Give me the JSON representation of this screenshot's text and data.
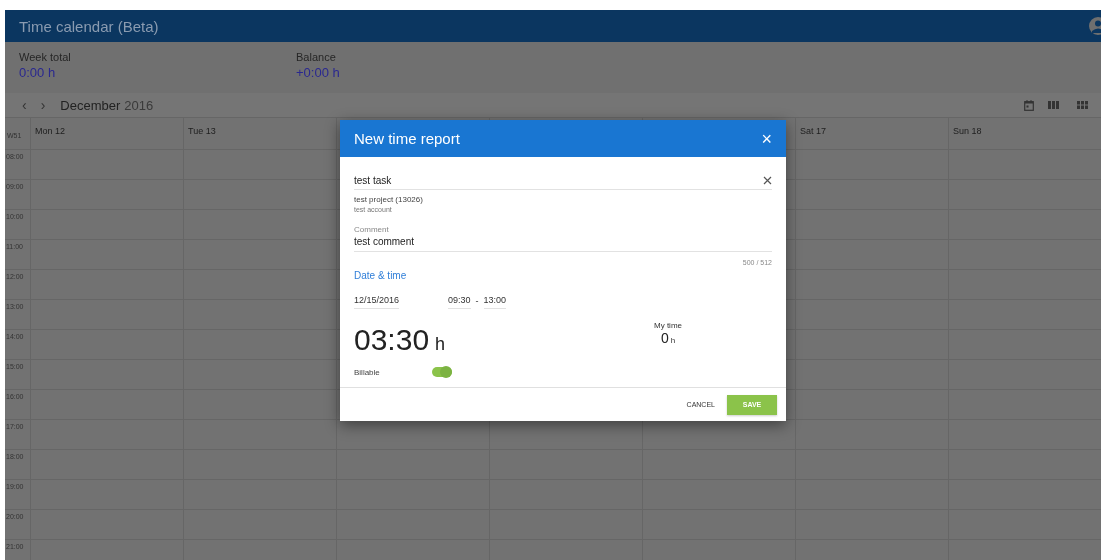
{
  "app_bar": {
    "title": "Time calendar (Beta)"
  },
  "summary": [
    {
      "label": "Week total",
      "value": "0:00 h"
    },
    {
      "label": "Balance",
      "value": "+0:00 h"
    }
  ],
  "toolbar": {
    "prev": "‹",
    "next": "›",
    "month": "December",
    "year": "2016"
  },
  "calendar": {
    "week": "W51",
    "days_left": [
      "Mon 12",
      "Tue 13"
    ],
    "days_right": [
      "Sat 17",
      "Sun 18"
    ],
    "hours": [
      "08:00",
      "09:00",
      "10:00",
      "11:00",
      "12:00",
      "13:00",
      "14:00",
      "15:00",
      "16:00",
      "17:00",
      "18:00",
      "19:00",
      "20:00",
      "21:00"
    ]
  },
  "dialog": {
    "title": "New time report",
    "close": "×",
    "task": {
      "value": "test task"
    },
    "project": "test project (13026)",
    "account": "test account",
    "comment": {
      "label": "Comment",
      "value": "test comment",
      "counter": "500 / 512"
    },
    "section": "Date & time",
    "date": "12/15/2016",
    "start": "09:30",
    "separator": "-",
    "end": "13:00",
    "duration": {
      "value": "03:30",
      "unit": "h"
    },
    "my_time": {
      "label": "My time",
      "value": "0",
      "unit": "h"
    },
    "billable": {
      "label": "Billable",
      "on": true
    },
    "buttons": [
      {
        "label": "CANCEL",
        "kind": "flat"
      },
      {
        "label": "SAVE",
        "kind": "raised"
      }
    ]
  }
}
